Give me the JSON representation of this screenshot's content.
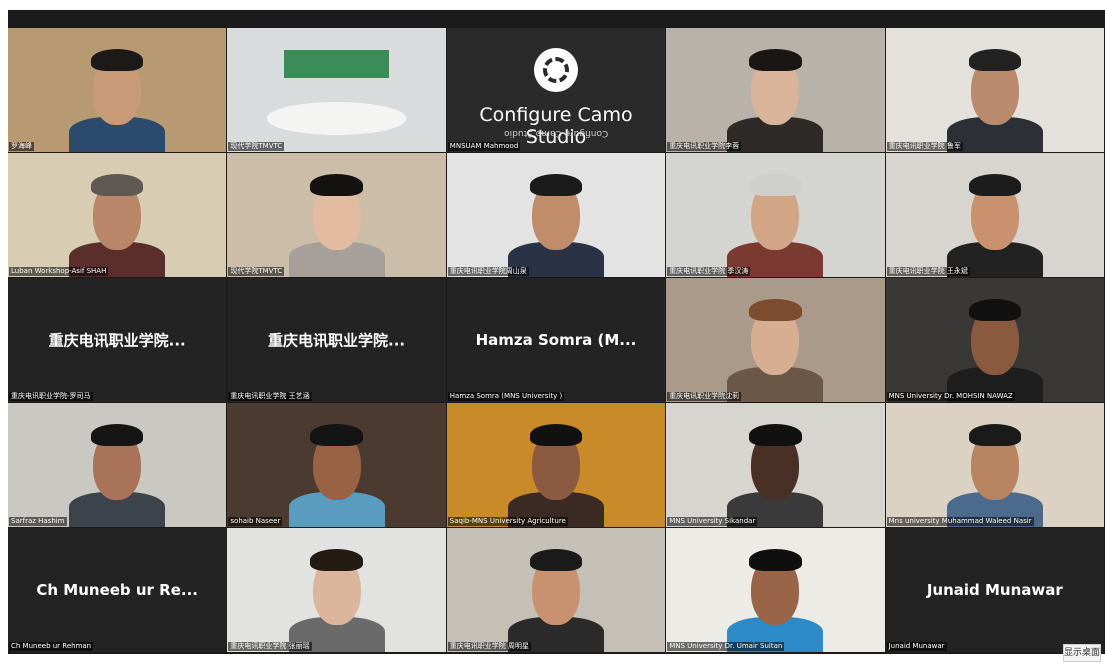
{
  "gallery": {
    "tiles": [
      {
        "label": "罗海峰",
        "type": "video",
        "bg": "#b89a72",
        "skin": "#c99a78",
        "hair": "#1c1a18",
        "shirt": "#2b4a6e"
      },
      {
        "label": "现代学院TMVTC",
        "type": "room",
        "bg": "#d9dcdd"
      },
      {
        "label": "MNSUAM Mahmood",
        "type": "camo",
        "title": "Configure Camo Studio",
        "mirror": "Configure Camo Studio"
      },
      {
        "label": "重庆电讯职业学院李蓉",
        "type": "video",
        "bg": "#b8b2aa",
        "skin": "#d9b39a",
        "hair": "#1a1614",
        "shirt": "#2e2a28"
      },
      {
        "label": "重庆电讯职业学院 鲁军",
        "type": "video",
        "bg": "#e4e1dc",
        "skin": "#b98a6c",
        "hair": "#222",
        "shirt": "#2c2f35"
      },
      {
        "label": "Luban Workshop-Asif SHAH",
        "type": "video",
        "bg": "#d8cdb2",
        "skin": "#b9866a",
        "hair": "#5e5954",
        "shirt": "#5a2e2a"
      },
      {
        "label": "现代学院TMVTC",
        "type": "video",
        "bg": "#cbbda8",
        "skin": "#e2bba0",
        "hair": "#141210",
        "shirt": "#a7a09a"
      },
      {
        "label": "重庆电讯职业学院周山泉",
        "type": "video",
        "bg": "#e3e3e3",
        "skin": "#c08c6a",
        "hair": "#1a1a1a",
        "shirt": "#2a3346"
      },
      {
        "label": "重庆电讯职业学院 季汉涛",
        "type": "video",
        "bg": "#d4d4d0",
        "skin": "#d1a586",
        "hair": "#cfcfcc",
        "shirt": "#7a3a32"
      },
      {
        "label": "重庆电讯职业学院 王永斌",
        "type": "video",
        "bg": "#d8d4cf",
        "skin": "#c9916e",
        "hair": "#1c1c1c",
        "shirt": "#222"
      },
      {
        "label": "重庆电讯职业学院-罗司马",
        "type": "name",
        "display": "重庆电讯职业学院..."
      },
      {
        "label": "重庆电讯职业学院 王艺涵",
        "type": "name",
        "display": "重庆电讯职业学院..."
      },
      {
        "label": "Hamza Somra (MNS University )",
        "type": "name",
        "display": "Hamza Somra (M..."
      },
      {
        "label": "重庆电讯职业学院沈莉",
        "type": "video",
        "bg": "#a99a8a",
        "skin": "#d8ae92",
        "hair": "#7b4c2e",
        "shirt": "#6b5848"
      },
      {
        "label": "MNS University Dr. MOHSIN NAWAZ",
        "type": "video",
        "bg": "#3a3836",
        "skin": "#8a5a3e",
        "hair": "#111",
        "shirt": "#1e1e1e"
      },
      {
        "label": "Sarfraz Hashim",
        "type": "video",
        "bg": "#c9c8c2",
        "skin": "#a9735a",
        "hair": "#151515",
        "shirt": "#3d434a"
      },
      {
        "label": "sohaib Naseer",
        "type": "video",
        "bg": "#4a3a30",
        "skin": "#9a6244",
        "hair": "#141414",
        "shirt": "#5a9cc0"
      },
      {
        "label": "Saqib-MNS University Agriculture",
        "type": "video",
        "bg": "#c98a2a",
        "skin": "#8c5a40",
        "hair": "#111",
        "shirt": "#3b2a24"
      },
      {
        "label": "MNS University Sikandar",
        "type": "video",
        "bg": "#d6d5d0",
        "skin": "#4a3024",
        "hair": "#111",
        "shirt": "#3a3a3a"
      },
      {
        "label": "Mns university Muhammad Waleed Nasir",
        "type": "video",
        "bg": "#dcd2c4",
        "skin": "#b88462",
        "hair": "#1a1a1a",
        "shirt": "#4c6a8c"
      },
      {
        "label": "Ch Muneeb ur Rehman",
        "type": "name",
        "display": "Ch Muneeb ur Re..."
      },
      {
        "label": "重庆电讯职业学院 张丽瑶",
        "type": "video",
        "bg": "#e2e2e0",
        "skin": "#dcb69c",
        "hair": "#231a14",
        "shirt": "#6a6a6a"
      },
      {
        "label": "重庆电讯职业学院 周明星",
        "type": "video",
        "bg": "#c4c0b8",
        "skin": "#c89270",
        "hair": "#1a1a1a",
        "shirt": "#2a2a2a"
      },
      {
        "label": "MNS University Dr. Umair Sultan",
        "type": "video",
        "bg": "#ecebe6",
        "skin": "#9a6448",
        "hair": "#0f0f0f",
        "shirt": "#2d8ac8"
      },
      {
        "label": "Junaid Munawar",
        "type": "name",
        "display": "Junaid Munawar"
      }
    ]
  },
  "desktop_button": "显示桌面",
  "colors": {
    "gallery_bg": "#1b1b1b",
    "tile_bg": "#232323"
  }
}
